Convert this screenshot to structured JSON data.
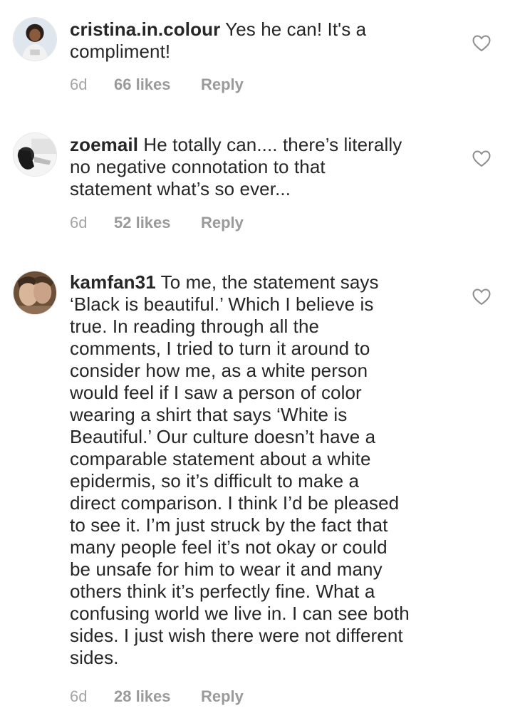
{
  "comments": [
    {
      "username": "cristina.in.colour",
      "lines": [
        "Yes he can! It's a",
        "compliment!"
      ],
      "age": "6d",
      "likes": "66 likes",
      "reply": "Reply",
      "avatar_icon": "user-avatar-photo",
      "like_icon": "heart-outline-icon"
    },
    {
      "username": "zoemail",
      "lines": [
        "He totally can.... there’s literally",
        "no negative connotation to that",
        "statement what’s so ever..."
      ],
      "age": "6d",
      "likes": "52 likes",
      "reply": "Reply",
      "avatar_icon": "user-avatar-photo",
      "like_icon": "heart-outline-icon"
    },
    {
      "username": "kamfan31",
      "lines": [
        "To me, the statement says",
        "‘Black is beautiful.’ Which I believe is",
        "true. In reading through all the",
        "comments, I tried to turn it around to",
        "consider how me, as a white person",
        "would feel if I saw a person of color",
        "wearing a shirt that says ‘White is",
        "Beautiful.’ Our culture doesn’t have a",
        "comparable statement about a white",
        "epidermis, so it’s difficult to make a",
        "direct comparison. I think I’d be pleased",
        "to see it. I’m just struck by the fact that",
        "many people feel it’s not okay or could",
        "be unsafe for him to wear it and many",
        "others think it’s perfectly fine. What a",
        "confusing world we live in. I can see both",
        "sides. I just wish there were not different",
        "sides."
      ],
      "age": "6d",
      "likes": "28 likes",
      "reply": "Reply",
      "avatar_icon": "user-avatar-photo",
      "like_icon": "heart-outline-icon"
    }
  ],
  "colors": {
    "text": "#262626",
    "meta": "#9a9a9a",
    "background": "#ffffff"
  }
}
